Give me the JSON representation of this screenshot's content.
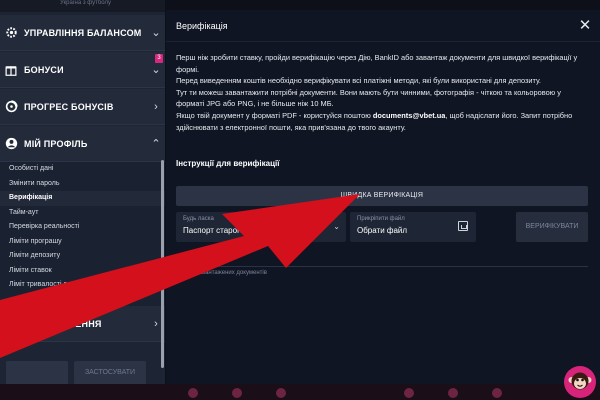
{
  "sidebar": {
    "top_text": "Україна з футболу",
    "items": [
      {
        "label": "УПРАВЛІННЯ БАЛАНСОМ",
        "icon": "gear-icon",
        "chevron": "chevron-down-icon"
      },
      {
        "label": "БОНУСИ",
        "icon": "gift-icon",
        "chevron": "chevron-down-icon",
        "badge": "3"
      },
      {
        "label": "ПРОГРЕС БОНУСІВ",
        "icon": "progress-icon",
        "chevron": "chevron-right-icon"
      },
      {
        "label": "МІЙ ПРОФІЛЬ",
        "icon": "user-icon",
        "chevron": "chevron-up-icon"
      },
      {
        "label": "ПОВІДОМЛЕННЯ",
        "icon": "envelope-icon",
        "chevron": "chevron-right-icon"
      }
    ],
    "profile_sub": [
      "Особисті дані",
      "Змінити пароль",
      "Верифікація",
      "Тайм-аут",
      "Перевірка реальності",
      "Ліміти програшу",
      "Ліміти депозиту",
      "Ліміти ставок",
      "Ліміт тривалості сесії"
    ],
    "active_sub": "Верифікація",
    "bottom_buttons": {
      "left": "",
      "right": "ЗАСТОСУВАТИ"
    }
  },
  "modal": {
    "title": "Верифікація",
    "close_label": "✕",
    "paragraphs": [
      "Перш ніж зробити ставку, пройди верифікацію через Дію, BankID або завантаж документи для швидкої верифікації у формі.",
      "Перед виведенням коштів необхідно верифікувати всі платіжні методи, які були використані для депозиту.",
      "Тут ти можеш завантажити потрібні документи. Вони мають бути чинними, фотографія - чіткою та кольоровою у форматі JPG або PNG, і не більше ніж 10 МБ."
    ],
    "pdf_text_before": "Якщо твій документ у форматі PDF - користуйся поштою ",
    "pdf_email": "documents@vbet.ua",
    "pdf_text_after": ", щоб надіслати його. Запит потрібно здійснювати з електронної пошти, яка прив'язана до твого акаунту.",
    "instructions_label": "Інструкції для верифікації",
    "fast_verify_label": "ШВИДКА ВЕРИФІКАЦІЯ",
    "doc_type": {
      "placeholder": "Будь ласка",
      "value": "Паспорт старого зразка (книжечка)"
    },
    "file": {
      "placeholder": "Прикріпити файл",
      "value": "Обрати файл"
    },
    "verify_label": "ВЕРИФІКУВАТИ",
    "uploaded_label": "Завантажені",
    "no_docs_label": "Немає завантажених документів"
  },
  "colors": {
    "arrow": "#d3101b",
    "accent": "#d6287f",
    "sidebar_bg": "#1d2433",
    "modal_bg": "#0f1523"
  }
}
